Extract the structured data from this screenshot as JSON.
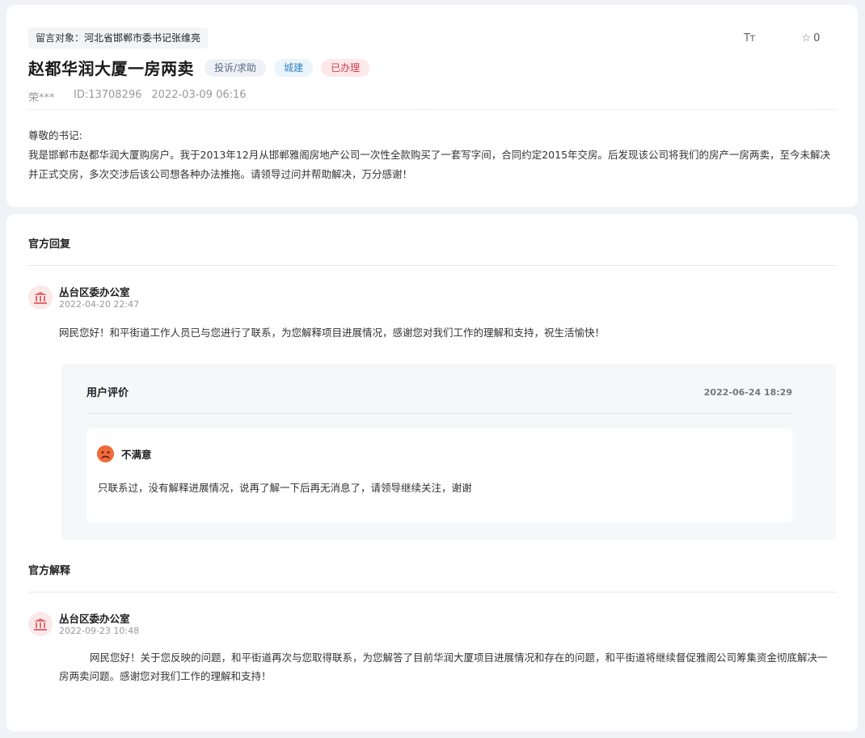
{
  "message": {
    "target_label": "留言对象：",
    "target_value": "河北省邯郸市委书记张维亮",
    "title": "赵都华润大厦一房两卖",
    "tags": {
      "type": "投诉/求助",
      "category": "城建",
      "status": "已办理"
    },
    "author": "荣***",
    "id": "ID:13708296",
    "time": "2022-03-09 06:16",
    "greeting": "尊敬的书记:",
    "content": "我是邯郸市赵都华润大厦购房户。我于2013年12月从邯郸雅阁房地产公司一次性全款购买了一套写字间，合同约定2015年交房。后发现该公司将我们的房产一房两卖，至今未解决并正式交房，多次交涉后该公司想各种办法推拖。请领导过问并帮助解决，万分感谢！",
    "font_tool": "Tт",
    "favorite_count": "0"
  },
  "official_reply": {
    "section_title": "官方回复",
    "department": "丛台区委办公室",
    "time": "2022-04-20 22:47",
    "content": "网民您好！和平街道工作人员已与您进行了联系，为您解释项目进展情况，感谢您对我们工作的理解和支持，祝生活愉快！"
  },
  "evaluation": {
    "title": "用户评价",
    "date": "2022-06-24 18:29",
    "mood": "不满意",
    "content": "只联系过，没有解释进展情况，说再了解一下后再无消息了，请领导继续关注，谢谢"
  },
  "official_explanation": {
    "section_title": "官方解释",
    "department": "丛台区委办公室",
    "time": "2022-09-23 10:48",
    "content": "网民您好！关于您反映的问题，和平街道再次与您取得联系，为您解答了目前华润大厦项目进展情况和存在的问题，和平街道将继续督促雅阁公司筹集资金彻底解决一房两卖问题。感谢您对我们工作的理解和支持！"
  },
  "colors": {
    "status_red": "#d33a4a",
    "category_blue": "#3a86c0",
    "dept_icon_red": "#e06b6b",
    "mood_orange": "#f06a3c"
  },
  "icons": {
    "font_size": "font-size-icon",
    "favorite": "star-outline-icon",
    "department": "government-building-icon",
    "mood": "sad-face-icon"
  }
}
